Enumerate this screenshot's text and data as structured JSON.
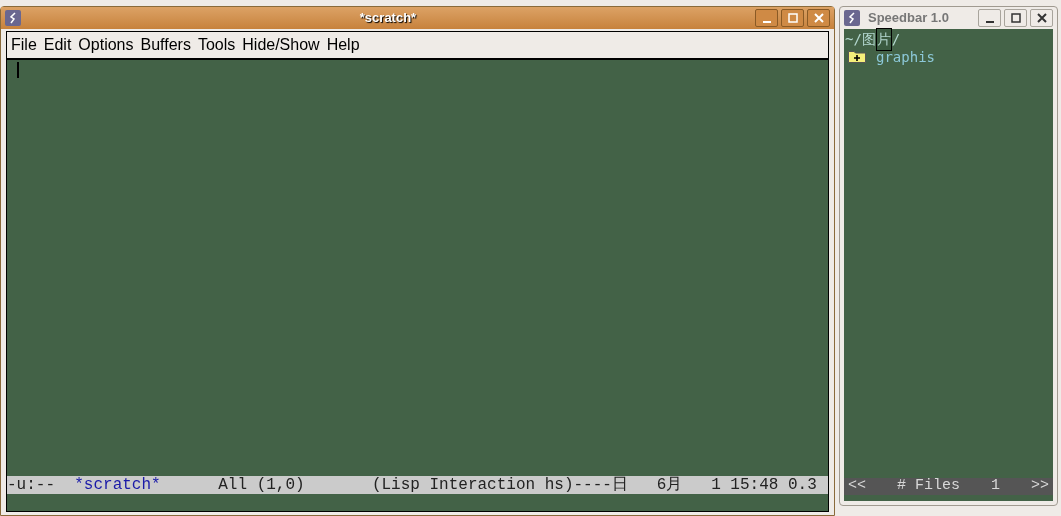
{
  "emacs_window": {
    "title": "*scratch*",
    "menu": [
      "File",
      "Edit",
      "Options",
      "Buffers",
      "Tools",
      "Hide/Show",
      "Help"
    ],
    "mode_line": {
      "status": "-u:--",
      "buffer_name": "*scratch*",
      "rest": "All (1,0)       (Lisp Interaction hs)----日   6月   1 15:48 0.3"
    }
  },
  "speedbar_window": {
    "title": "Speedbar 1.0",
    "path": [
      {
        "text": "~/图",
        "cursor": false
      },
      {
        "text": "片",
        "cursor": true
      },
      {
        "text": "/",
        "cursor": false
      }
    ],
    "items": [
      {
        "kind": "folder",
        "label": "graphis"
      }
    ],
    "footer": [
      "<<",
      "# Files",
      "1",
      ">>"
    ]
  }
}
